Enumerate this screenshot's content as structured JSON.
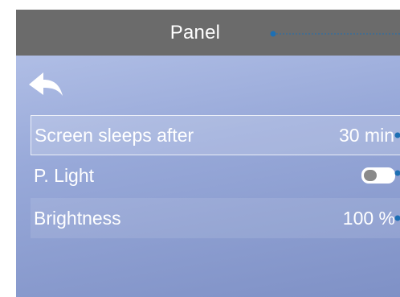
{
  "header": {
    "title": "Panel"
  },
  "nav": {
    "back_icon": "back-arrow-icon"
  },
  "settings": [
    {
      "label": "Screen sleeps after",
      "value": "30 min",
      "selected": true
    },
    {
      "label": "P. Light",
      "value": "",
      "control": "toggle",
      "toggle_on": false
    },
    {
      "label": "Brightness",
      "value": "100 %"
    }
  ],
  "colors": {
    "titlebar": "#6b6b6b",
    "background_top": "#b9c6ea",
    "background_bottom": "#7f91c6",
    "callout": "#1d6fb3",
    "text": "#ffffff"
  }
}
